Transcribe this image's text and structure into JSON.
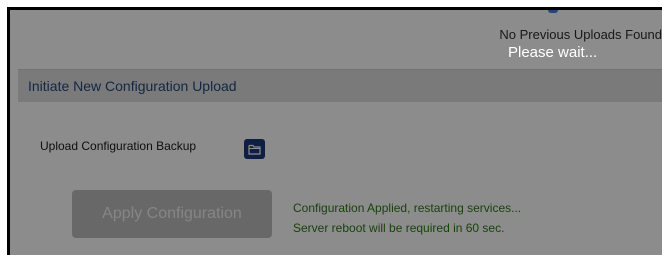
{
  "previous_uploads": {
    "message": "No Previous Uploads Found"
  },
  "loading": {
    "message": "Please wait..."
  },
  "section": {
    "title": "Initiate New Configuration Upload"
  },
  "upload": {
    "label": "Upload Configuration Backup",
    "icon": "folder-icon"
  },
  "apply": {
    "label": "Apply Configuration",
    "disabled": true
  },
  "status": {
    "line1": "Configuration Applied, restarting services...",
    "line2": "Server reboot will be required in 60 sec.",
    "color": "#2a7a14"
  },
  "colors": {
    "header_text": "#234a7e",
    "upload_button": "#1d3a7a",
    "overlay": "rgba(0,0,0,0.45)"
  }
}
